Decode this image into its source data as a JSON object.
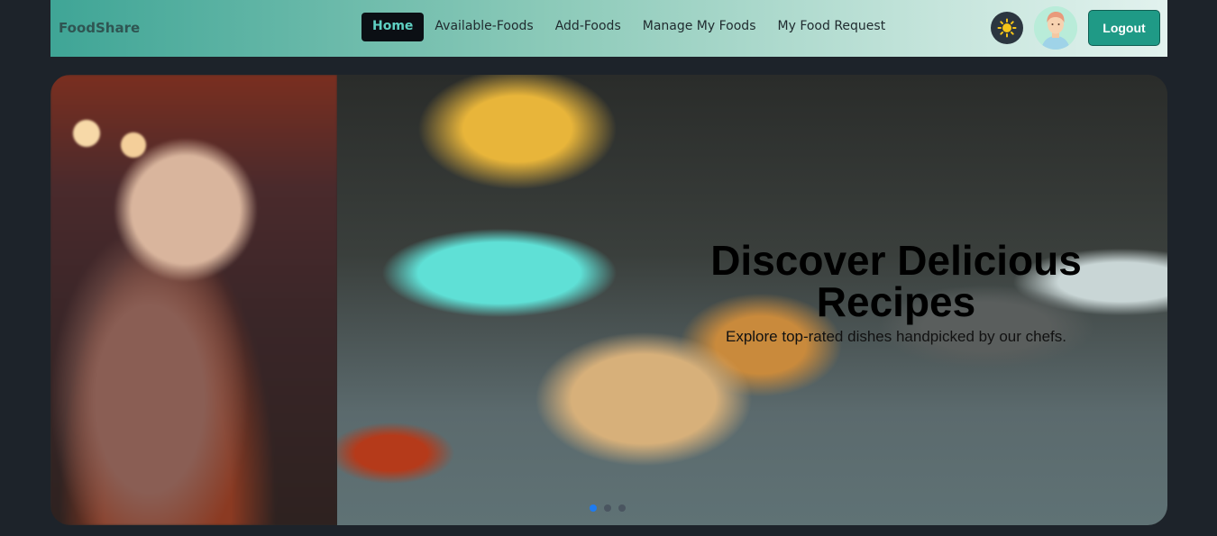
{
  "navbar": {
    "brand": "FoodShare",
    "links": [
      {
        "label": "Home",
        "active": true
      },
      {
        "label": "Available-Foods",
        "active": false
      },
      {
        "label": "Add-Foods",
        "active": false
      },
      {
        "label": "Manage My Foods",
        "active": false
      },
      {
        "label": "My Food Request",
        "active": false
      }
    ],
    "theme_toggle_icon": "sun-icon",
    "avatar_icon": "user-avatar-icon",
    "logout_label": "Logout"
  },
  "hero": {
    "title": "Discover Delicious Recipes",
    "subtitle": "Explore top-rated dishes handpicked by our chefs.",
    "slides_count": 3,
    "active_slide": 1
  },
  "colors": {
    "accent": "#1f9a86",
    "active_link_bg": "#0b0f14",
    "active_dot": "#1e7bf0",
    "page_bg": "#1d232a"
  }
}
